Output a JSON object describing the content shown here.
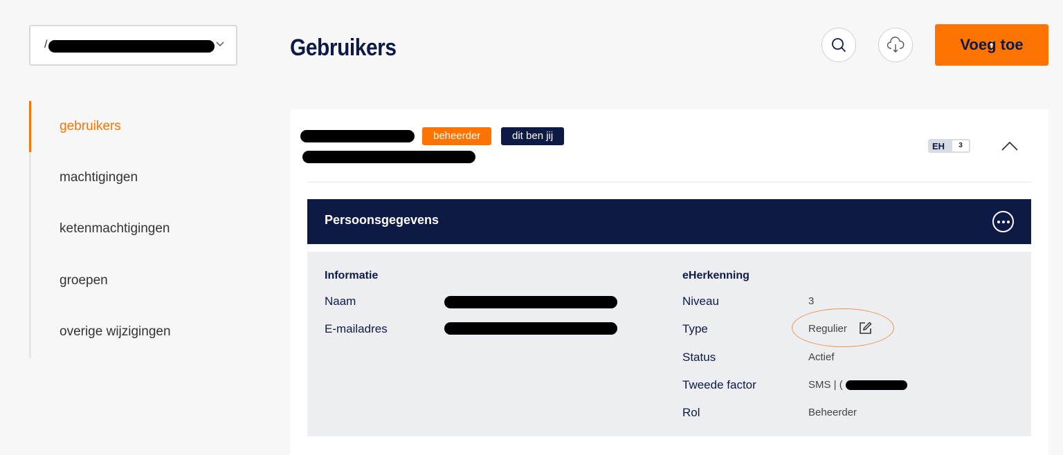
{
  "org_selector": {
    "prefix": "/"
  },
  "header": {
    "title": "Gebruikers",
    "add_button": {
      "icon": "+",
      "label": "Voeg toe"
    },
    "search_icon": "search-icon",
    "download_icon": "cloud-download-icon"
  },
  "sidenav": {
    "items": [
      {
        "label": "gebruikers",
        "active": true
      },
      {
        "label": "machtigingen",
        "active": false
      },
      {
        "label": "ketenmachtigingen",
        "active": false
      },
      {
        "label": "groepen",
        "active": false
      },
      {
        "label": "overige wijzigingen",
        "active": false
      }
    ]
  },
  "user_card": {
    "badges": {
      "role": "beheerder",
      "self": "dit ben jij"
    },
    "eh_level": {
      "prefix": "EH",
      "level": "3"
    },
    "section": {
      "title": "Persoonsgegevens",
      "info": {
        "heading": "Informatie",
        "name_label": "Naam",
        "email_label": "E-mailadres"
      },
      "eherkenning": {
        "heading": "eHerkenning",
        "rows": [
          {
            "label": "Niveau",
            "value": "3"
          },
          {
            "label": "Type",
            "value": "Regulier"
          },
          {
            "label": "Status",
            "value": "Actief"
          },
          {
            "label": "Tweede factor",
            "value": "SMS | ("
          },
          {
            "label": "Rol",
            "value": "Beheerder"
          }
        ]
      }
    }
  },
  "colors": {
    "accent": "#ff7300",
    "navy": "#0e1a46",
    "panel": "#eceef1"
  }
}
